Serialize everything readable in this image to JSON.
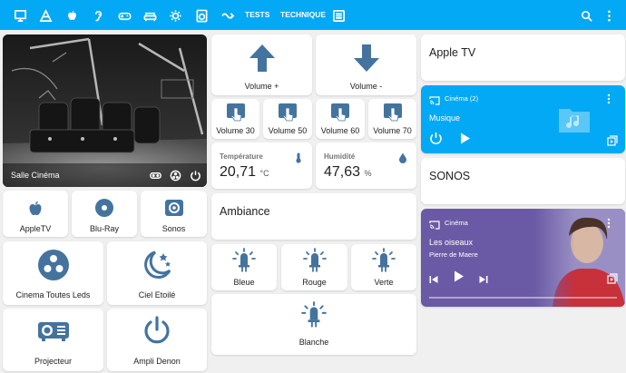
{
  "topbar": {
    "tab_tests": "TESTS",
    "tab_technique": "TECHNIQUE",
    "icons": [
      "cinema-screen-icon",
      "pyramid-icon",
      "apple-icon",
      "hearing-icon",
      "gamepad-icon",
      "sofa-icon",
      "light-icon",
      "washing-machine-icon",
      "cast-waves-icon",
      "list-icon",
      "search-icon",
      "more-icon"
    ]
  },
  "camera": {
    "title": "Salle Cinéma"
  },
  "sources": [
    {
      "label": "AppleTV",
      "icon": "apple-icon"
    },
    {
      "label": "Blu-Ray",
      "icon": "disc-icon"
    },
    {
      "label": "Sonos",
      "icon": "speaker-icon"
    }
  ],
  "scenes": [
    {
      "label": "Cinema Toutes Leds",
      "icon": "led-cluster-icon"
    },
    {
      "label": "Ciel Etoilé",
      "icon": "star-night-icon"
    },
    {
      "label": "Projecteur",
      "icon": "projector-icon"
    },
    {
      "label": "Ampli Denon",
      "icon": "power-icon"
    }
  ],
  "volume": {
    "up_label": "Volume +",
    "down_label": "Volume -",
    "presets": [
      "Volume 30",
      "Volume 50",
      "Volume 60",
      "Volume 70"
    ]
  },
  "sensors": {
    "temperature": {
      "label": "Température",
      "value": "20,71",
      "unit": "°C"
    },
    "humidity": {
      "label": "Humidité",
      "value": "47,63",
      "unit": "%"
    }
  },
  "ambiance": {
    "title": "Ambiance",
    "lights": [
      "Bleue",
      "Rouge",
      "Verte"
    ],
    "light_wide": "Blanche"
  },
  "right": {
    "apple_tv_title": "Apple TV",
    "cinema2_name": "Cinéma (2)",
    "cinema2_app": "Musique",
    "sonos_title": "SONOS",
    "cinema_name": "Cinéma",
    "track_title": "Les oiseaux",
    "track_artist": "Pierre de Maere"
  },
  "colors": {
    "accent": "#03a9f4",
    "icon": "#44739e",
    "media_purple": "#6a5aa5"
  }
}
